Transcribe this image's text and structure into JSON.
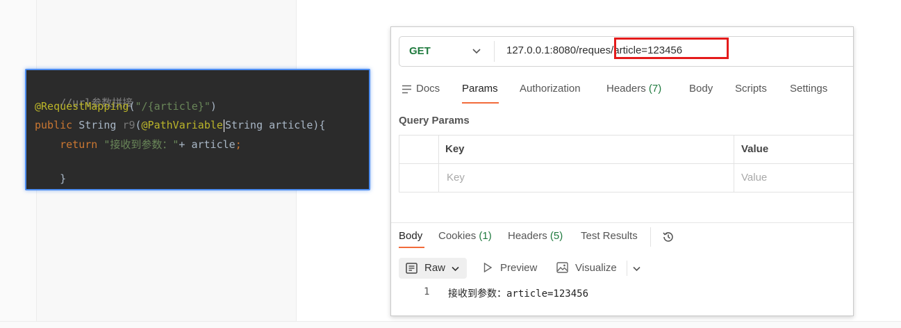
{
  "code": {
    "comment": "//url参数拼接",
    "mapping_annotation": "@RequestMapping",
    "mapping_paren_open": "(",
    "mapping_arg": "\"/{article}\"",
    "mapping_paren_close": ")",
    "kw_public": "public",
    "type_string": "String",
    "method_name": "r9",
    "paren_open": "(",
    "path_var": "@PathVariable",
    "param_type": "String",
    "param_name": "article",
    "sig_end": "){",
    "kw_return": "return",
    "return_str": "\"接收到参数：\"",
    "return_rest": "+ article",
    "semicolon": ";",
    "close_brace": "}"
  },
  "request": {
    "method": "GET",
    "url_prefix": "127.0.0.1:8080/reques",
    "url_highlight": "/article=123456"
  },
  "request_tabs": [
    {
      "label": "Docs",
      "count": ""
    },
    {
      "label": "Params",
      "count": ""
    },
    {
      "label": "Authorization",
      "count": ""
    },
    {
      "label": "Headers",
      "count": "(7)"
    },
    {
      "label": "Body",
      "count": ""
    },
    {
      "label": "Scripts",
      "count": ""
    },
    {
      "label": "Settings",
      "count": ""
    }
  ],
  "query_params": {
    "title": "Query Params",
    "col_key": "Key",
    "col_value": "Value",
    "placeholder_key": "Key",
    "placeholder_value": "Value"
  },
  "response_tabs": [
    {
      "label": "Body",
      "count": ""
    },
    {
      "label": "Cookies",
      "count": "(1)"
    },
    {
      "label": "Headers",
      "count": "(5)"
    },
    {
      "label": "Test Results",
      "count": ""
    }
  ],
  "response_view": {
    "raw_label": "Raw",
    "preview_label": "Preview",
    "visualize_label": "Visualize"
  },
  "response_body": {
    "line_number": "1",
    "text": "接收到参数：article=123456"
  },
  "colors": {
    "accent_underline": "#f26b3a",
    "method_green": "#1f7a3e",
    "highlight_red": "#e41b1b",
    "code_bg": "#2b2b2b",
    "code_border": "#4c8cf0"
  },
  "icons": [
    "docs-icon",
    "chevron-down-icon",
    "history-icon",
    "raw-format-icon",
    "play-icon",
    "image-icon"
  ]
}
